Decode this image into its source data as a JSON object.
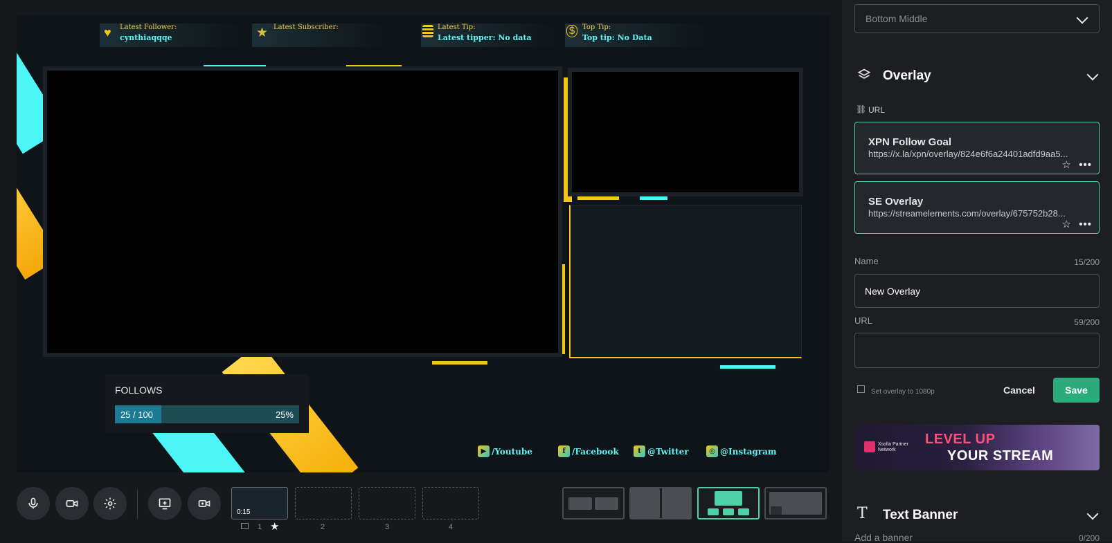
{
  "stage": {
    "tickers": [
      {
        "label": "Latest Follower:",
        "value": "cynthiaqqqe",
        "icon": "heart-icon"
      },
      {
        "label": "Latest Subscriber:",
        "value": "",
        "icon": "star-icon"
      },
      {
        "label": "Latest Tip:",
        "value": "Latest tipper: No data",
        "icon": "coins-icon"
      },
      {
        "label": "Top Tip:",
        "value": "Top tip: No Data",
        "icon": "money-bag-icon"
      }
    ],
    "follow_goal": {
      "title": "FOLLOWS",
      "count_text": "25 / 100",
      "percent_text": "25%",
      "progress": 0.25
    },
    "socials": [
      {
        "label": "/Youtube",
        "icon": "youtube-icon",
        "glyph": "▶"
      },
      {
        "label": "/Facebook",
        "icon": "facebook-icon",
        "glyph": "f"
      },
      {
        "label": "@Twitter",
        "icon": "twitter-icon",
        "glyph": "t"
      },
      {
        "label": "@Instagram",
        "icon": "instagram-icon",
        "glyph": "◎"
      }
    ],
    "colors": {
      "cyan": "#4cf6f6",
      "yellow": "#f5c518",
      "teal_text": "#63f0f0"
    }
  },
  "toolbar": {
    "scenes": [
      {
        "number": "1",
        "time": "0:15"
      },
      {
        "number": "2"
      },
      {
        "number": "3"
      },
      {
        "number": "4"
      }
    ],
    "active_layout": 3
  },
  "panel": {
    "position_select_value": "Bottom Middle",
    "overlay_section_title": "Overlay",
    "url_label": "URL",
    "overlays": [
      {
        "name": "XPN Follow Goal",
        "url": "https://x.la/xpn/overlay/824e6f6a24401adfd9aa5..."
      },
      {
        "name": "SE Overlay",
        "url": "https://streamelements.com/overlay/675752b28..."
      }
    ],
    "name_field": {
      "label": "Name",
      "count": "15/200",
      "value": "New Overlay"
    },
    "url_field": {
      "label": "URL",
      "count": "59/200",
      "value": ""
    },
    "set_1080_label": "Set overlay to 1080p",
    "cancel_label": "Cancel",
    "save_label": "Save",
    "promo": {
      "brand": "Xsolla Partner Network",
      "line1": "LEVEL UP",
      "line2": "YOUR STREAM"
    },
    "text_banner": {
      "title": "Text Banner",
      "placeholder": "Add a banner",
      "count": "0/200"
    },
    "accent": "#4fd1a5"
  }
}
